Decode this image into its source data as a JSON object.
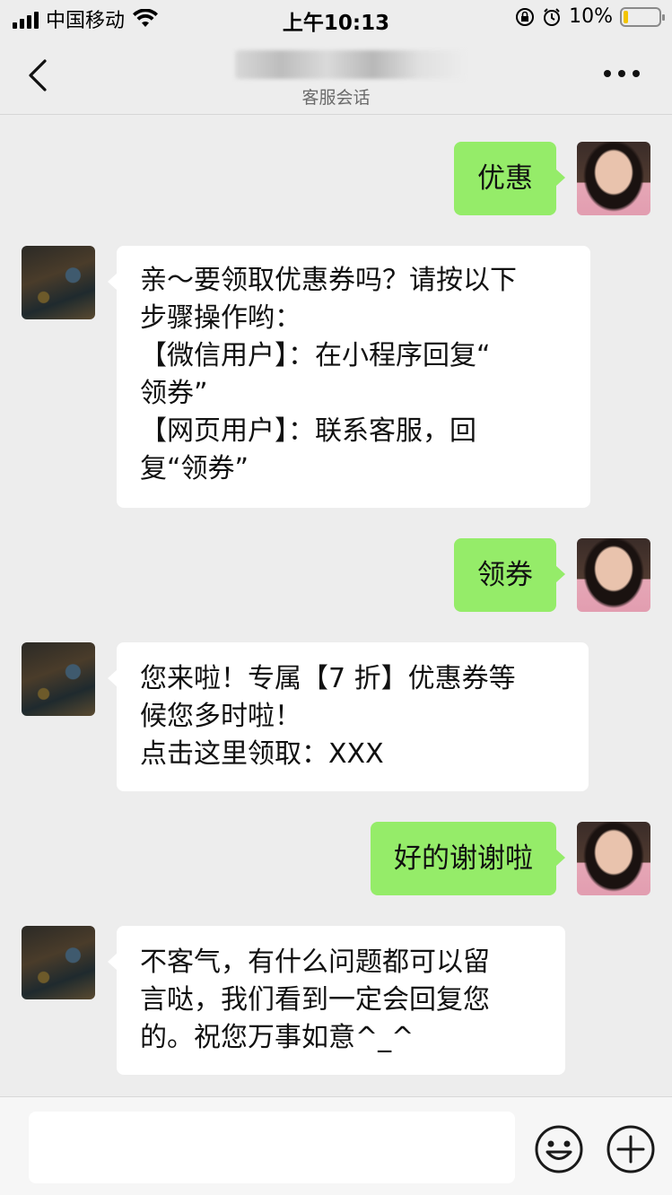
{
  "status_bar": {
    "carrier": "中国移动",
    "time": "上午10:13",
    "battery": "10%"
  },
  "nav": {
    "subtitle": "客服会话"
  },
  "messages": [
    {
      "side": "right",
      "text": "优惠"
    },
    {
      "side": "left",
      "text": "亲～要领取优惠券吗？请按以下\n步骤操作哟：\n【微信用户】：在小程序回复“\n领券”\n【网页用户】：联系客服，回\n复“领券”"
    },
    {
      "side": "right",
      "text": "领券"
    },
    {
      "side": "left",
      "text": "您来啦！专属【7 折】优惠券等\n候您多时啦！\n点击这里领取：XXX"
    },
    {
      "side": "right",
      "text": "好的谢谢啦"
    },
    {
      "side": "left",
      "text": "不客气，有什么问题都可以留\n言哒，我们看到一定会回复您\n的。祝您万事如意^_^"
    }
  ],
  "input": {
    "placeholder": ""
  },
  "colors": {
    "background": "#ededed",
    "sent_bubble": "#95ec69",
    "received_bubble": "#ffffff",
    "battery_level": "#f2c400"
  },
  "icons": [
    "back-arrow-icon",
    "more-dots-icon",
    "emoji-icon",
    "plus-icon",
    "signal-icon",
    "wifi-icon",
    "lock-rotation-icon",
    "alarm-icon",
    "battery-icon"
  ]
}
